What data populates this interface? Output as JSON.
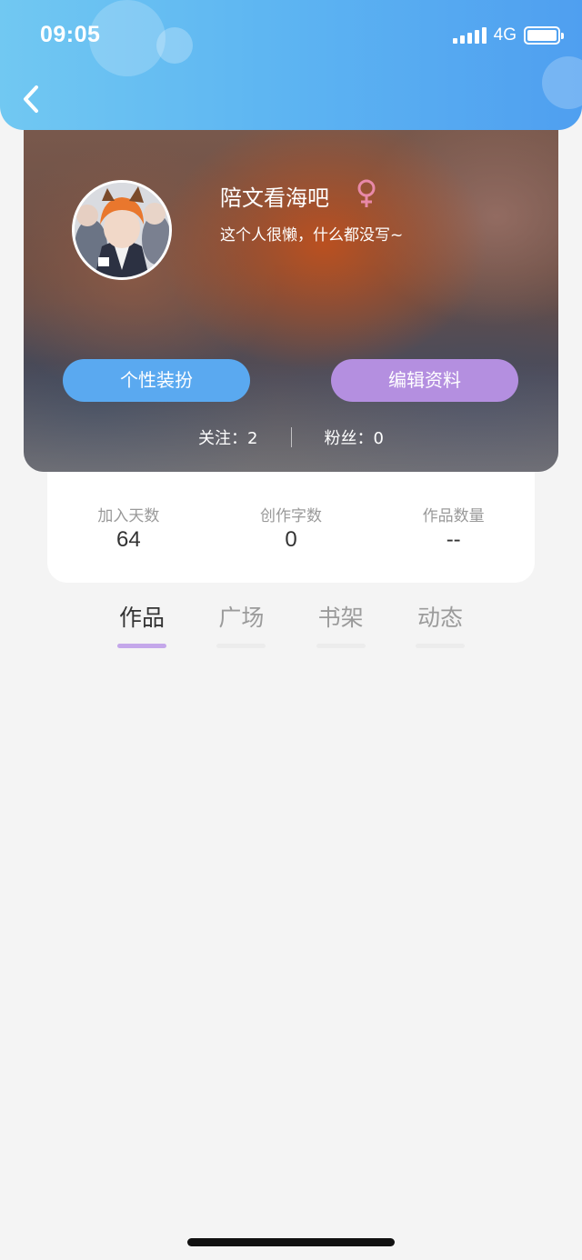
{
  "status_bar": {
    "time": "09:05",
    "network": "4G"
  },
  "profile": {
    "name": "陪文看海吧",
    "bio": "这个人很懒，什么都没写~",
    "gender_color": "#e889a8",
    "buttons": {
      "style": "个性装扮",
      "edit": "编辑资料"
    },
    "follow": {
      "following": "关注：2",
      "fans": "粉丝：0"
    }
  },
  "stats": [
    {
      "label": "加入天数",
      "value": "64"
    },
    {
      "label": "创作字数",
      "value": "0"
    },
    {
      "label": "作品数量",
      "value": "--"
    }
  ],
  "tabs": [
    {
      "label": "作品",
      "active": true
    },
    {
      "label": "广场",
      "active": false
    },
    {
      "label": "书架",
      "active": false
    },
    {
      "label": "动态",
      "active": false
    }
  ],
  "colors": {
    "header_gradient_start": "#71c8f2",
    "header_gradient_end": "#4f9ff0",
    "btn_style": "#5aa9f0",
    "btn_edit": "#b48fe0",
    "tab_active_underline": "#c4a7ea"
  }
}
